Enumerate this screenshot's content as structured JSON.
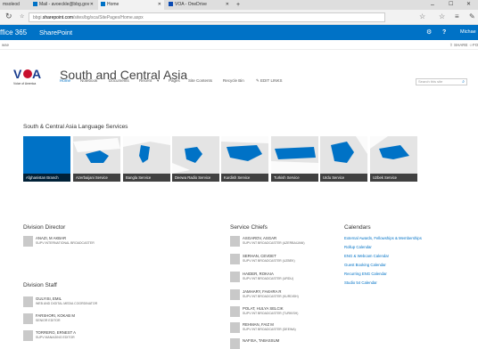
{
  "browser": {
    "tabs": [
      {
        "label": "msoleod",
        "active": false
      },
      {
        "label": "Mail - avoeckle@bbg.gov",
        "active": false
      },
      {
        "label": "Home",
        "active": true
      },
      {
        "label": "VOA - OneDrive",
        "active": false
      }
    ],
    "url_prefix": "bbgi",
    "url_host": "sharepoint.com",
    "url_path": "/sites/bg/sca/SitePages/Home.aspx"
  },
  "suite_bar": {
    "app_name": "ffice 365",
    "site_name": "SharePoint",
    "user": "Michae"
  },
  "command_bar": {
    "left": "wse",
    "share": "SHARE",
    "follow": "FO"
  },
  "site": {
    "title": "South and Central Asia",
    "nav": [
      {
        "label": "Home",
        "selected": true
      },
      {
        "label": "Notebook",
        "selected": false
      },
      {
        "label": "Documents",
        "selected": false
      },
      {
        "label": "Recent",
        "selected": false
      },
      {
        "label": "Pages",
        "selected": false
      },
      {
        "label": "Site Contents",
        "selected": false
      },
      {
        "label": "Recycle Bin",
        "selected": false
      },
      {
        "label": "EDIT LINKS",
        "selected": false
      }
    ],
    "search_placeholder": "Search this site"
  },
  "language_services": {
    "title": "South & Central Asia Language Services",
    "tiles": [
      "Afghanistan Branch",
      "Azerbaijani Service",
      "Bangla Service",
      "Deewa Radio Service",
      "Kurdish Service",
      "Turkish Service",
      "Urdu Service",
      "Uzbek Service"
    ]
  },
  "division_director": {
    "title": "Division Director",
    "people": [
      {
        "name": "ANAZI, M AKBAR",
        "role": "SUPV INTERNATIONAL BROADCASTER"
      }
    ]
  },
  "division_staff": {
    "title": "Division Staff",
    "people": [
      {
        "name": "GULYISI, EMIL",
        "role": "WEB AND DIGITAL MEDIA COORDINATOR"
      },
      {
        "name": "FARSHORI, KOKAB M",
        "role": "SENIOR EDITOR"
      },
      {
        "name": "TORRERO, ERNEST A",
        "role": "SUPV MANAGING EDITOR"
      }
    ]
  },
  "service_chiefs": {
    "title": "Service Chiefs",
    "people": [
      {
        "name": "ASGAROV, ASGAR",
        "role": "SUPV INT BROADCASTER (AZERBAIJANI)"
      },
      {
        "name": "SERHAN, CEVDET",
        "role": "SUPV INT BROADCASTER (UZBEK)"
      },
      {
        "name": "HAIDER, ROKAIA",
        "role": "SUPV INT BROADCASTER (URDU)"
      },
      {
        "name": "JAMHARY, FAKHRA R",
        "role": "SUPV INT BROADCASTER (KURDISH)"
      },
      {
        "name": "POLAT, HULYA SELCIK",
        "role": "SUPV INT BROADCASTER (TURKISH)"
      },
      {
        "name": "REHMAN, FAIZ M",
        "role": "SUPV INT BROADCASTER (DEEWA)"
      },
      {
        "name": "NAFISA, TABASSUM",
        "role": ""
      }
    ]
  },
  "calendars": {
    "title": "Calendars",
    "links": [
      "External Awards, Fellowships & Memberships",
      "Rollup Calendar",
      "ENG & Webcam Calendar",
      "Guest Booking Calendar",
      "Recurring ENG Calendar",
      "Studio 54 Calendar"
    ]
  },
  "colors": {
    "brand_blue": "#0072c6",
    "voa_red": "#c8102e",
    "voa_blue": "#1a3d8f"
  }
}
